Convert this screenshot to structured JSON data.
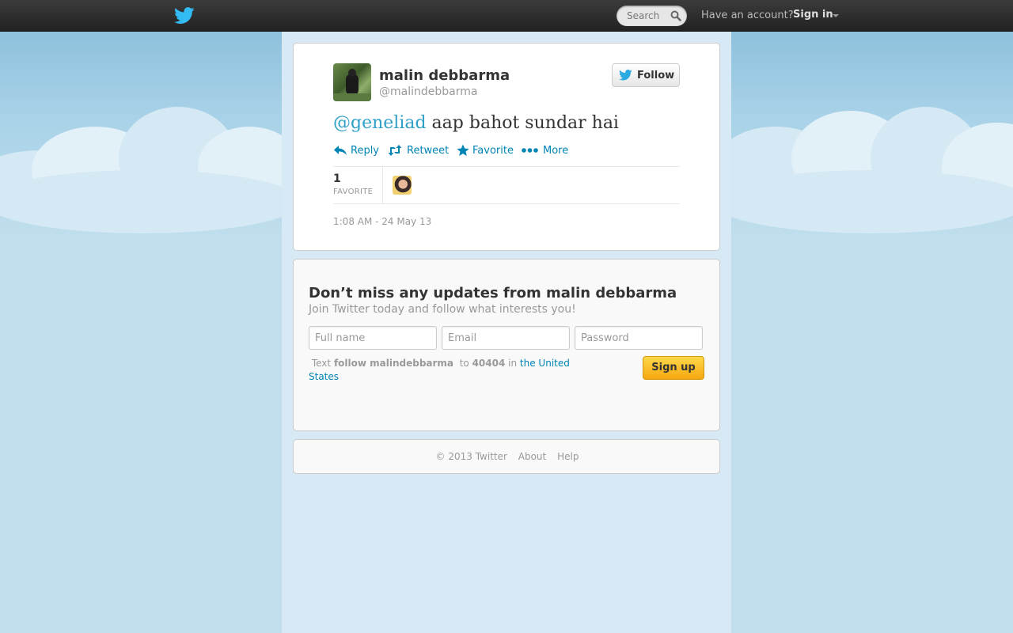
{
  "topbar": {
    "search_placeholder": "Search",
    "have_account": "Have an account?",
    "sign_in": "Sign in"
  },
  "tweet": {
    "fullname": "malin debbarma",
    "screenname": "@malindebbarma",
    "follow_label": "Follow",
    "mention": "@geneliad",
    "text": " aap bahot sundar hai",
    "actions": {
      "reply": "Reply",
      "retweet": "Retweet",
      "favorite": "Favorite",
      "more": "More"
    },
    "stats": {
      "count": "1",
      "label": "FAVORITE"
    },
    "timestamp": "1:08 AM - 24 May 13"
  },
  "signup": {
    "title": "Don’t miss any updates from malin debbarma",
    "subtitle": "Join Twitter today and follow what interests you!",
    "fullname_placeholder": "Full name",
    "email_placeholder": "Email",
    "password_placeholder": "Password",
    "sms_prefix": "Text",
    "sms_command": "follow malindebbarma",
    "sms_to": "to",
    "sms_number": "40404",
    "sms_in": "in",
    "sms_country": "the United States",
    "button": "Sign up"
  },
  "footer": {
    "copyright": "© 2013 Twitter",
    "about": "About",
    "help": "Help"
  },
  "colors": {
    "link": "#0084b4",
    "mention": "#2fa0c8",
    "signup_button": "#f5a70f",
    "background": "#c0deed"
  }
}
